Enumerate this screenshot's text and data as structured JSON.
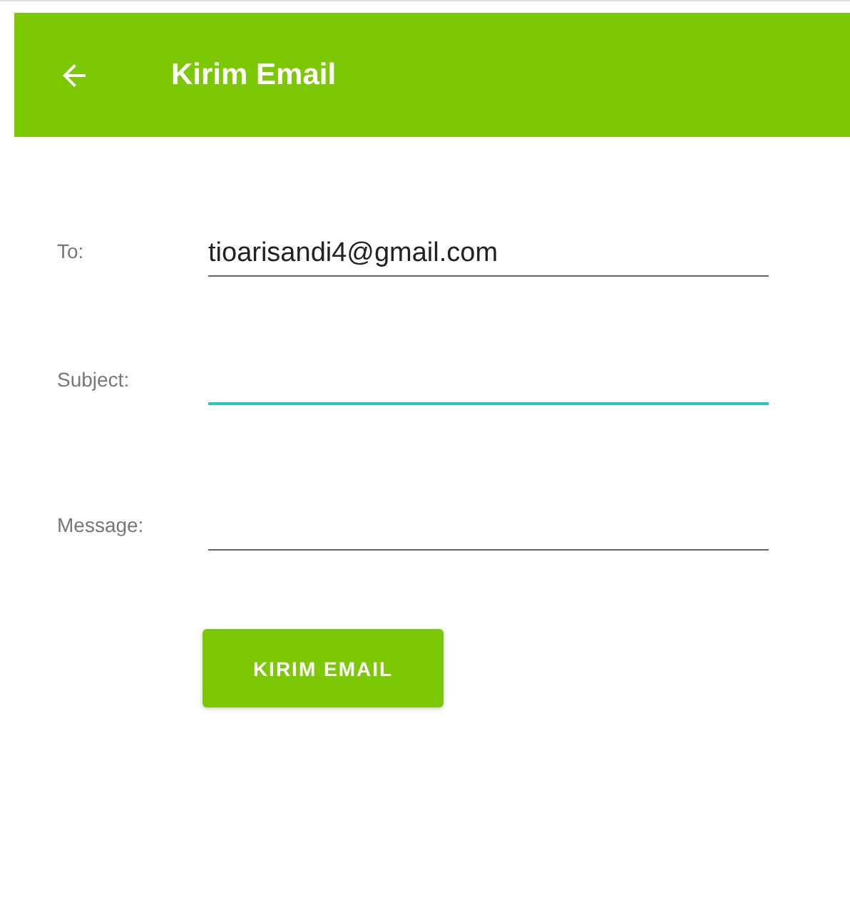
{
  "app_bar": {
    "title": "Kirim Email"
  },
  "fields": [
    {
      "label": "To:",
      "value": "tioarisandi4@gmail.com",
      "focused": false
    },
    {
      "label": "Subject:",
      "focused": true
    },
    {
      "label": "Message:",
      "focused": false
    }
  ],
  "button": {
    "label": "KIRIM EMAIL"
  }
}
